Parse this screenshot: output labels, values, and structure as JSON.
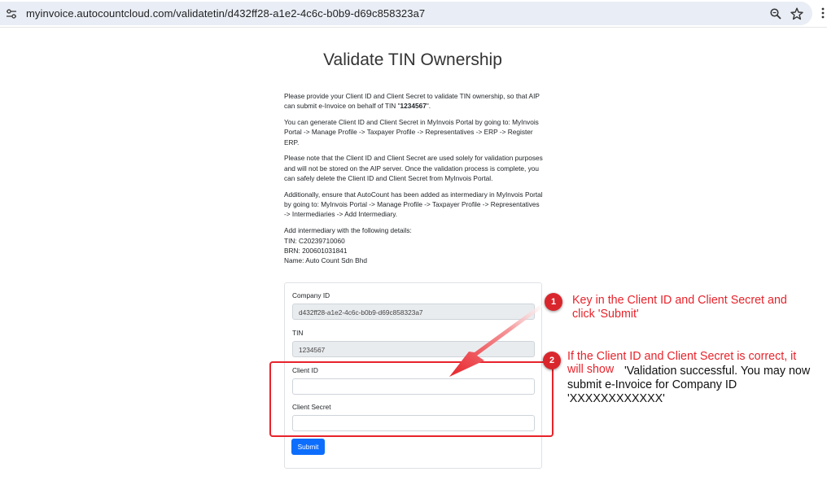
{
  "browser": {
    "url": "myinvoice.autocountcloud.com/validatetin/d432ff28-a1e2-4c6c-b0b9-d69c858323a7"
  },
  "page": {
    "title": "Validate TIN Ownership",
    "p1_before": "Please provide your Client ID and Client Secret to validate TIN ownership, so that AIP can submit e-Invoice on behalf of TIN \"",
    "p1_tin": "1234567",
    "p1_after": "\".",
    "p2": "You can generate Client ID and Client Secret in MyInvois Portal by going to: MyInvois Portal -> Manage Profile -> Taxpayer Profile -> Representatives -> ERP -> Register ERP.",
    "p3": "Please note that the Client ID and Client Secret are used solely for validation purposes and will not be stored on the AIP server. Once the validation process is complete, you can safely delete the Client ID and Client Secret from MyInvois Portal.",
    "p4": "Additionally, ensure that AutoCount has been added as intermediary in MyInvois Portal by going to: MyInvois Portal -> Manage Profile -> Taxpayer Profile -> Representatives -> Intermediaries -> Add Intermediary.",
    "p5_heading": "Add intermediary with the following details:",
    "p5_tin": "TIN: C20239710060",
    "p5_brn": "BRN: 200601031841",
    "p5_name": "Name: Auto Count Sdn Bhd"
  },
  "form": {
    "company_id_label": "Company ID",
    "company_id_value": "d432ff28-a1e2-4c6c-b0b9-d69c858323a7",
    "tin_label": "TIN",
    "tin_value": "1234567",
    "client_id_label": "Client ID",
    "client_id_value": "",
    "client_secret_label": "Client Secret",
    "client_secret_value": "",
    "submit_label": "Submit"
  },
  "annotations": {
    "badge1": "1",
    "note1": "Key in the Client ID and Client Secret and click 'Submit'",
    "badge2": "2",
    "note2_red": "If the Client ID and Client Secret is correct, it",
    "note2_will_show": "will show",
    "note2_black": "'Validation successful. You may now submit e-Invoice for Company ID 'XXXXXXXXXXXX'",
    "accent_color": "#e8232b"
  },
  "icons": {
    "site_info": "tune-icon",
    "zoom": "zoom-icon",
    "bookmark": "star-icon",
    "menu": "more-vert-icon"
  }
}
